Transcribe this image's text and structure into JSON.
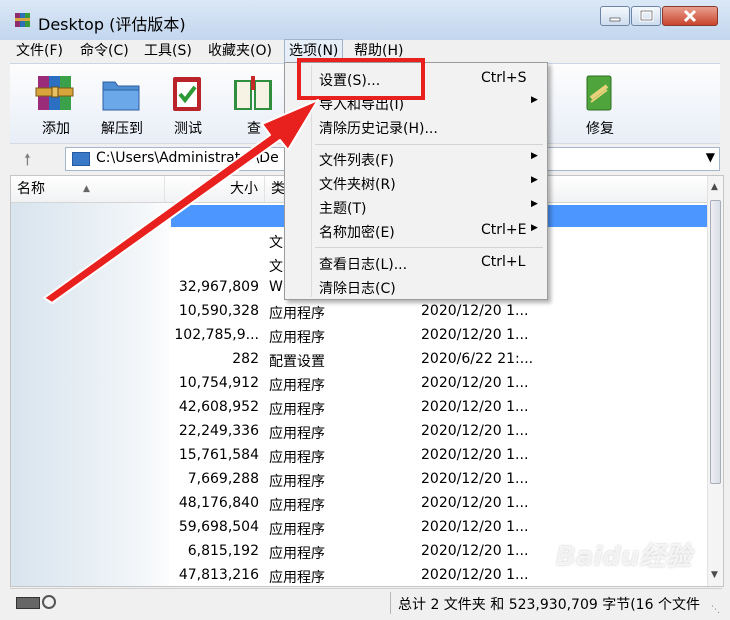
{
  "window": {
    "title": "Desktop (评估版本)"
  },
  "menubar": [
    {
      "label": "文件(F)"
    },
    {
      "label": "命令(C)"
    },
    {
      "label": "工具(S)"
    },
    {
      "label": "收藏夹(O)"
    },
    {
      "label": "选项(N)"
    },
    {
      "label": "帮助(H)"
    }
  ],
  "toolbar": {
    "add": "添加",
    "extract": "解压到",
    "test": "测试",
    "view_partial": "查",
    "repair": "修复"
  },
  "address": {
    "path": "C:\\Users\\Administrator\\De"
  },
  "columns": {
    "name": "名称",
    "size": "大小",
    "type_partial": "类"
  },
  "rows": [
    {
      "size": "",
      "type": "文",
      "date": ""
    },
    {
      "size": "",
      "type": "文",
      "date": ""
    },
    {
      "size": "32,967,809",
      "type": "W",
      "date": ""
    },
    {
      "size": "10,590,328",
      "type": "应用程序",
      "date": "2020/12/20 1..."
    },
    {
      "size": "102,785,9...",
      "type": "应用程序",
      "date": "2020/12/20 1..."
    },
    {
      "size": "282",
      "type": "配置设置",
      "date": "2020/6/22 21:..."
    },
    {
      "size": "10,754,912",
      "type": "应用程序",
      "date": "2020/12/20 1..."
    },
    {
      "size": "42,608,952",
      "type": "应用程序",
      "date": "2020/12/20 1..."
    },
    {
      "size": "22,249,336",
      "type": "应用程序",
      "date": "2020/12/20 1..."
    },
    {
      "size": "15,761,584",
      "type": "应用程序",
      "date": "2020/12/20 1..."
    },
    {
      "size": "7,669,288",
      "type": "应用程序",
      "date": "2020/12/20 1..."
    },
    {
      "size": "48,176,840",
      "type": "应用程序",
      "date": "2020/12/20 1..."
    },
    {
      "size": "59,698,504",
      "type": "应用程序",
      "date": "2020/12/20 1..."
    },
    {
      "size": "6,815,192",
      "type": "应用程序",
      "date": "2020/12/20 1..."
    },
    {
      "size": "47,813,216",
      "type": "应用程序",
      "date": "2020/12/20 1..."
    }
  ],
  "options_menu": {
    "settings": {
      "label": "设置(S)...",
      "shortcut": "Ctrl+S"
    },
    "import_export": {
      "label": "导入和导出(I)"
    },
    "clear_history": {
      "label": "清除历史记录(H)..."
    },
    "file_list": {
      "label": "文件列表(F)"
    },
    "folder_tree": {
      "label": "文件夹树(R)"
    },
    "theme": {
      "label": "主题(T)"
    },
    "name_encryption": {
      "label": "名称加密(E)",
      "shortcut": "Ctrl+E"
    },
    "view_log": {
      "label": "查看日志(L)...",
      "shortcut": "Ctrl+L"
    },
    "clear_log": {
      "label": "清除日志(C)"
    }
  },
  "status": {
    "text": "总计 2 文件夹 和 523,930,709 字节(16 个文件"
  },
  "watermark": "Baidu经验",
  "colors": {
    "highlight_box": "#e8201e",
    "arrow": "#e8201e",
    "selection": "#4c97ff"
  }
}
